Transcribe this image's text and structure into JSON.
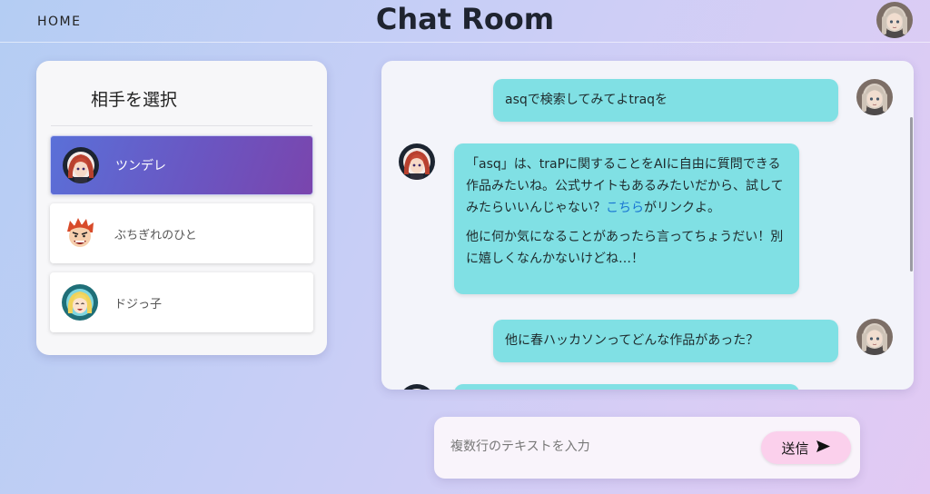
{
  "header": {
    "home_label": "HOME",
    "title": "Chat Room"
  },
  "partners": {
    "heading": "相手を選択",
    "items": [
      {
        "label": "ツンデレ",
        "selected": true
      },
      {
        "label": "ぶちぎれのひと",
        "selected": false
      },
      {
        "label": "ドジっ子",
        "selected": false
      }
    ]
  },
  "chat": {
    "messages": [
      {
        "sender": "user",
        "paragraphs": [
          "asqで検索してみてよtraqを"
        ]
      },
      {
        "sender": "bot",
        "paragraphs": [
          {
            "before": "「asq」は、traPに関することをAIに自由に質問できる作品みたいね。公式サイトもあるみたいだから、試してみたらいいんじゃない？",
            "link": "こちら",
            "after": "がリンクよ。"
          },
          "他に何か気になることがあったら言ってちょうだい！別に嬉しくなんかないけどね…！"
        ]
      },
      {
        "sender": "user",
        "paragraphs": [
          "他に春ハッカソンってどんな作品があった？"
        ]
      }
    ]
  },
  "composer": {
    "placeholder": "複数行のテキストを入力",
    "send_label": "送信"
  },
  "colors": {
    "bubble": "#80e0e4",
    "selected_gradient_start": "#5a70d8",
    "selected_gradient_end": "#7a45ad",
    "send_button": "#fbd0ec",
    "link": "#1976d2"
  },
  "icons": {
    "send": "send-arrow-icon",
    "user_avatar": "silver-haired-avatar",
    "tsundere_avatar": "red-haired-girl-avatar",
    "angry_avatar": "angry-red-haired-man-avatar",
    "clumsy_avatar": "blonde-girl-avatar"
  }
}
